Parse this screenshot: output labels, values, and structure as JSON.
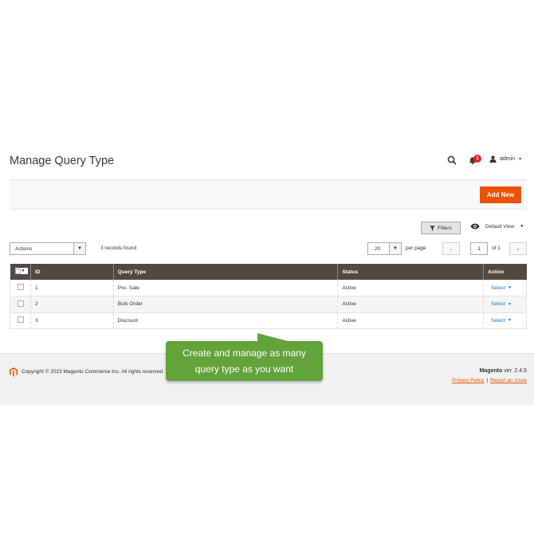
{
  "page": {
    "title": "Manage Query Type"
  },
  "header": {
    "notification_count": "1",
    "user_name": "admin"
  },
  "toolbar": {
    "add_new_label": "Add New",
    "filters_label": "Filters",
    "default_view_label": "Default View",
    "actions_label": "Actions",
    "records_found": "3 records found",
    "per_page_value": "20",
    "per_page_label": "per page",
    "page_value": "1",
    "page_of": "of 1"
  },
  "grid": {
    "columns": [
      "ID",
      "Query Type",
      "Status",
      "Action"
    ],
    "rows": [
      {
        "id": "1",
        "query_type": "Pre- Sale",
        "status": "Active",
        "action": "Select"
      },
      {
        "id": "2",
        "query_type": "Bulk Order",
        "status": "Active",
        "action": "Select"
      },
      {
        "id": "3",
        "query_type": "Discount",
        "status": "Active",
        "action": "Select"
      }
    ]
  },
  "tooltip": {
    "line1": "Create and manage as many",
    "line2": "query type as you want"
  },
  "footer": {
    "copyright": "Copyright © 2023 Magento Commerce Inc. All rights reserved.",
    "brand": "Magento",
    "version": " ver. 2.4.5",
    "privacy_policy": "Privacy Policy",
    "separator": "|",
    "report_issue": "Report an Issue"
  },
  "colors": {
    "accent": "#eb5202",
    "grid_header": "#514943",
    "tooltip_bg": "#62a33a",
    "link": "#007bdb"
  },
  "icons": [
    "search-icon",
    "bell-icon",
    "user-icon",
    "filter-icon",
    "eye-icon",
    "magento-logo-icon"
  ]
}
